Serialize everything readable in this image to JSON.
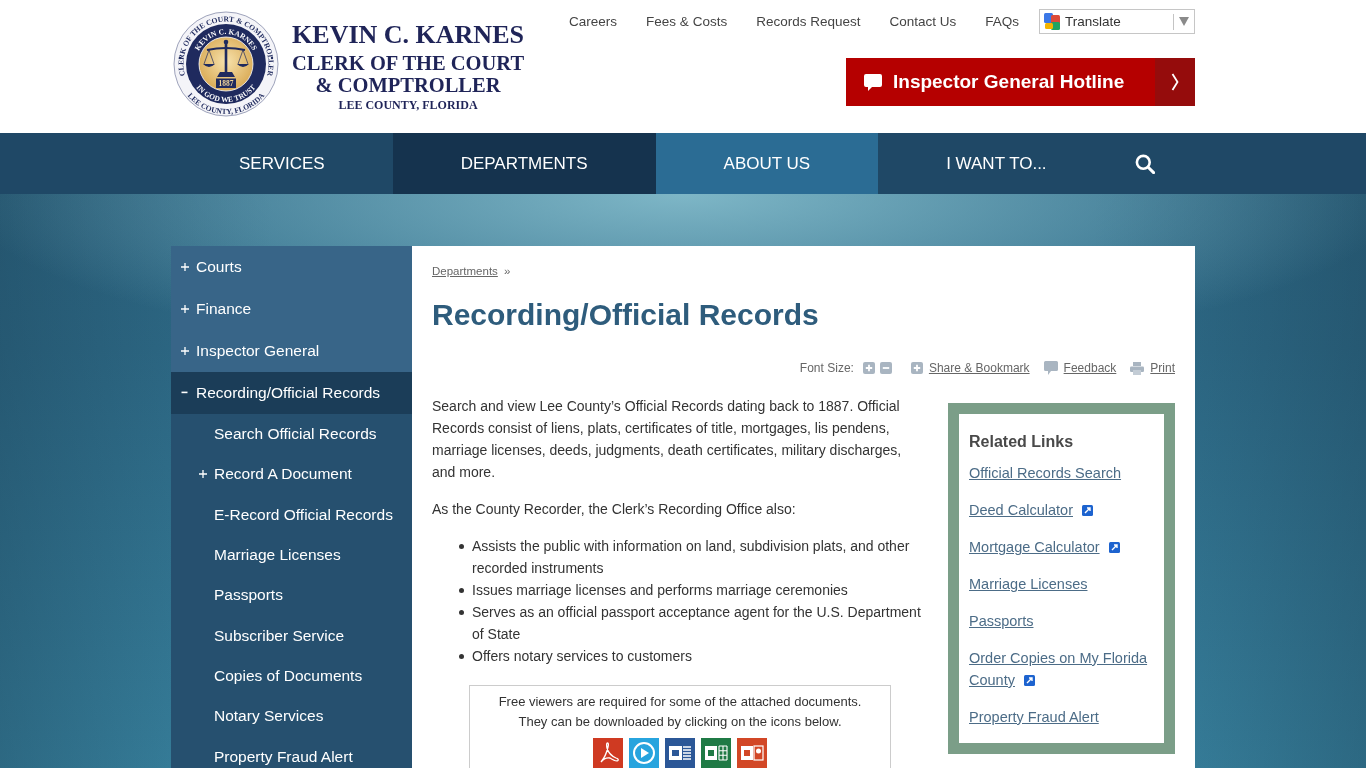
{
  "header": {
    "seal": {
      "outer_top": "CLERK OF THE COURT & COMPTROLLER",
      "inner_top": "KEVIN C. KARNES",
      "year": "1887",
      "inner_bottom": "IN GOD WE TRUST",
      "outer_bottom": "LEE COUNTY, FLORIDA"
    },
    "logo_lines": [
      {
        "kind": "name",
        "text": "KEVIN C. KARNES"
      },
      {
        "kind": "office",
        "text": "CLERK OF THE COURT"
      },
      {
        "kind": "office",
        "text": "& COMPTROLLER"
      },
      {
        "kind": "place",
        "text": "LEE COUNTY, FLORIDA"
      }
    ],
    "top_links": [
      "Careers",
      "Fees & Costs",
      "Records Request",
      "Contact Us",
      "FAQs"
    ],
    "translate": {
      "value": "Translate"
    },
    "hotline_button": {
      "label": "Inspector General Hotline"
    }
  },
  "nav": [
    {
      "label": "SERVICES",
      "selected": false,
      "hovered": false
    },
    {
      "label": "DEPARTMENTS",
      "selected": true,
      "hovered": false
    },
    {
      "label": "ABOUT US",
      "selected": false,
      "hovered": true
    },
    {
      "label": "I WANT TO...",
      "selected": false,
      "hovered": false
    }
  ],
  "sidebar": {
    "items": [
      {
        "label": "Courts",
        "selected": false,
        "expanded": false
      },
      {
        "label": "Finance",
        "selected": false,
        "expanded": false
      },
      {
        "label": "Inspector General",
        "selected": false,
        "expanded": false
      },
      {
        "label": "Recording/Official Records",
        "selected": true,
        "expanded": true,
        "children": [
          {
            "label": "Search Official Records",
            "selected": false
          },
          {
            "label": "Record A Document",
            "selected": false,
            "expanded": false
          },
          {
            "label": "E-Record Official Records",
            "selected": false
          },
          {
            "label": "Marriage Licenses",
            "selected": false
          },
          {
            "label": "Passports",
            "selected": false
          },
          {
            "label": "Subscriber Service",
            "selected": false
          },
          {
            "label": "Copies of Documents",
            "selected": false
          },
          {
            "label": "Notary Services",
            "selected": false
          },
          {
            "label": "Property Fraud Alert",
            "selected": false
          }
        ]
      }
    ]
  },
  "main": {
    "breadcrumb": [
      {
        "label": "Departments",
        "separator": "»"
      }
    ],
    "title": "Recording/Official Records",
    "tools": {
      "font_size_label": "Font Size:",
      "links": [
        {
          "kind": "share",
          "label": "Share & Bookmark"
        },
        {
          "kind": "feedback",
          "label": "Feedback"
        },
        {
          "kind": "print",
          "label": "Print"
        }
      ]
    },
    "paragraphs": [
      "Search and view Lee County’s Official Records dating back to 1887. Official Records consist of liens, plats, certificates of title, mortgages, lis pendens, marriage licenses, deeds, judgments, death certificates, military discharges, and more.",
      "As the County Recorder, the Clerk’s Recording Office also:"
    ],
    "duties": [
      "Assists the public with information on land, subdivision plats, and other recorded instruments",
      "Issues marriage licenses and performs marriage ceremonies",
      "Serves as an official passport acceptance agent for the U.S. Department of State",
      "Offers notary services to customers"
    ],
    "viewer_notice": {
      "lines": [
        "Free viewers are required for some of the attached documents.",
        "They can be downloaded by clicking on the icons below."
      ]
    },
    "related_links": {
      "heading": "Related Links",
      "links": [
        {
          "label": "Official Records Search",
          "external": false
        },
        {
          "label": "Deed Calculator",
          "external": true
        },
        {
          "label": "Mortgage Calculator",
          "external": true
        },
        {
          "label": "Marriage Licenses",
          "external": false
        },
        {
          "label": "Passports",
          "external": false
        },
        {
          "label": "Order Copies on My Florida County",
          "external": true
        },
        {
          "label": "Property Fraud Alert",
          "external": false
        }
      ]
    }
  }
}
